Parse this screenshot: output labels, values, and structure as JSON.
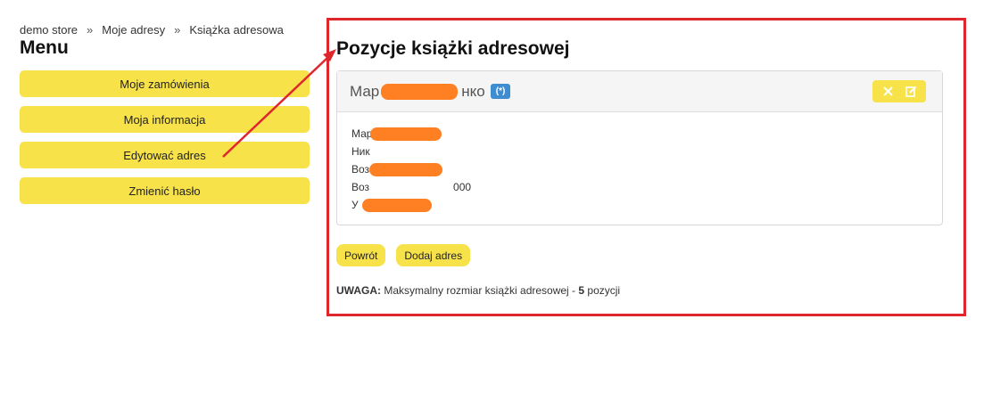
{
  "breadcrumb": {
    "items": [
      "demo store",
      "Moje adresy",
      "Książka adresowa"
    ],
    "separator": "»"
  },
  "menu": {
    "title": "Menu",
    "items": [
      {
        "label": "Moje zamówienia"
      },
      {
        "label": "Moja informacja"
      },
      {
        "label": "Edytować adres"
      },
      {
        "label": "Zmienić hasło"
      }
    ]
  },
  "main": {
    "title": "Pozycje książki adresowej",
    "card": {
      "name_start": "Мар",
      "name_end": "нко",
      "badge": "(*)",
      "address_lines": [
        "Мар",
        "Ник",
        "Воз",
        "Воз",
        "У"
      ],
      "address_line_4_suffix": "000"
    },
    "buttons": {
      "back": "Powrót",
      "add": "Dodaj adres"
    },
    "note": {
      "label": "UWAGA:",
      "text": " Maksymalny rozmiar książki adresowej - ",
      "count": "5",
      "suffix": " pozycji"
    }
  },
  "colors": {
    "button_yellow": "#f7e24a",
    "annotation_red": "#e0262d",
    "redaction_orange": "#ff7f23",
    "badge_blue": "#3d8dd0"
  },
  "icons": [
    "close-icon",
    "edit-icon"
  ]
}
